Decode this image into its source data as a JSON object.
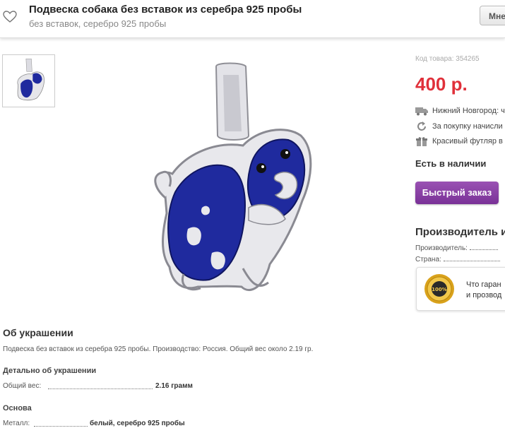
{
  "header": {
    "title": "Подвеска собака без вставок из серебра 925 пробы",
    "subtitle": "без вставок, серебро 925 пробы",
    "button_label": "Мне"
  },
  "product": {
    "sku": "Код товара: 354265",
    "price": "400 р.",
    "delivery": "Нижний Новгород: ч",
    "bonus": "За покупку начисли",
    "gift": "Красивый футляр в",
    "stock": "Есть в наличии",
    "quick_order": "Быстрый заказ"
  },
  "manufacturer": {
    "heading": "Производитель и",
    "producer_label": "Производитель:",
    "country_label": "Страна:"
  },
  "guarantee": {
    "line1": "Что гаран",
    "line2": "и прозвод"
  },
  "about": {
    "heading": "Об украшении",
    "description": "Подвеска без вставок из серебра 925 пробы. Производство: Россия. Общий вес около 2.19 гр.",
    "details_heading": "Детально об украшении",
    "weight_label": "Общий вес:",
    "weight_value": "2.16 грамм",
    "base_heading": "Основа",
    "metal_label": "Металл:",
    "metal_value": "белый, серебро 925 пробы"
  },
  "colors": {
    "price": "#e0303a",
    "button": "#8a3fa5",
    "enamel": "#1f2a9e",
    "silver": "#e6e6ea"
  }
}
